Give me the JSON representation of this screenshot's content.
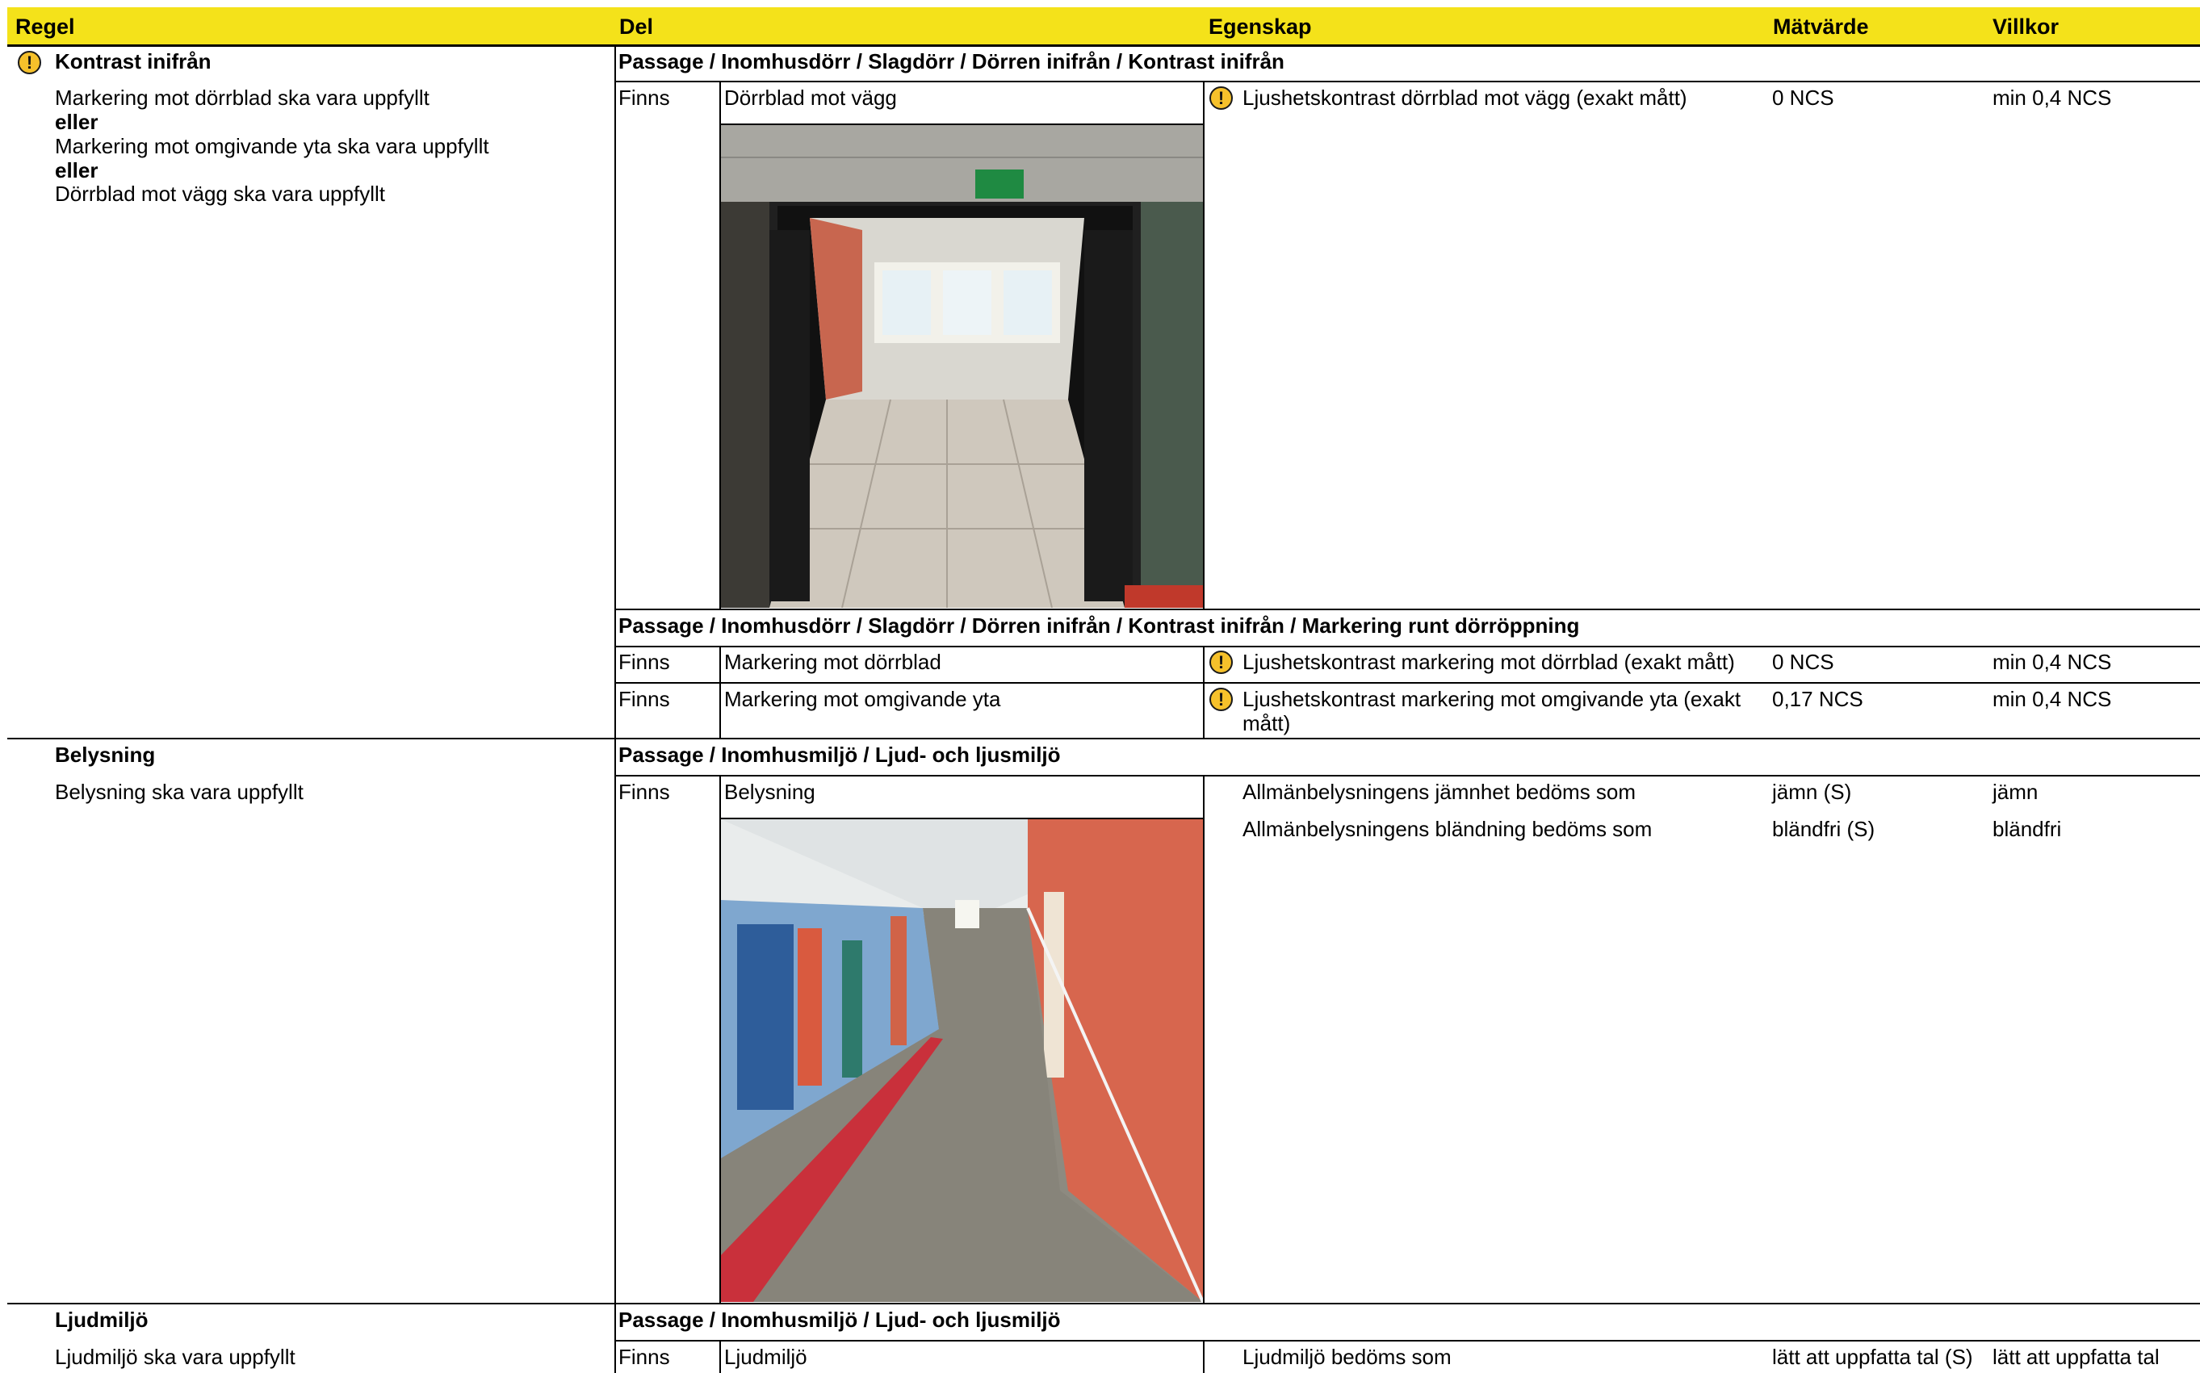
{
  "header": {
    "regel": "Regel",
    "del": "Del",
    "egenskap": "Egenskap",
    "matvarde": "Mätvärde",
    "villkor": "Villkor"
  },
  "colors": {
    "header_bg": "#f4e21a",
    "warning": "#f6c12b"
  },
  "icons": {
    "warning": "warning-icon"
  },
  "sections": [
    {
      "rule_title": "Kontrast inifrån",
      "rule_lines": [
        "Markering mot dörrblad ska vara uppfyllt",
        "eller",
        "Markering mot omgivande yta ska vara uppfyllt",
        "eller",
        "Dörrblad mot vägg ska vara uppfyllt"
      ],
      "groups": [
        {
          "path": "Passage / Inomhusdörr / Slagdörr / Dörren inifrån / Kontrast inifrån",
          "rows": [
            {
              "status": "Finns",
              "part": "Dörrblad mot vägg",
              "property": "Ljushetskontrast dörrblad mot vägg (exakt mått)",
              "value": "0 NCS",
              "condition": "min 0,4 NCS"
            }
          ]
        },
        {
          "path": "Passage / Inomhusdörr / Slagdörr / Dörren inifrån / Kontrast inifrån / Markering runt dörröppning",
          "rows": [
            {
              "status": "Finns",
              "part": "Markering mot dörrblad",
              "property": "Ljushetskontrast markering mot dörrblad (exakt mått)",
              "value": "0 NCS",
              "condition": "min 0,4 NCS"
            },
            {
              "status": "Finns",
              "part": "Markering mot omgivande yta",
              "property": "Ljushetskontrast markering mot omgivande yta (exakt",
              "property_line2": "mått)",
              "value": "0,17 NCS",
              "condition": "min 0,4 NCS"
            }
          ]
        }
      ]
    },
    {
      "rule_title": "Belysning",
      "rule_lines": [
        "Belysning ska vara uppfyllt"
      ],
      "groups": [
        {
          "path": "Passage / Inomhusmiljö / Ljud- och ljusmiljö",
          "rows": [
            {
              "status": "Finns",
              "part": "Belysning",
              "property": "Allmänbelysningens jämnhet bedöms som",
              "value": "jämn (S)",
              "condition": "jämn"
            },
            {
              "property": "Allmänbelysningens bländning bedöms som",
              "value": "bländfri (S)",
              "condition": "bländfri"
            }
          ]
        }
      ]
    },
    {
      "rule_title": "Ljudmiljö",
      "rule_lines": [
        "Ljudmiljö ska vara uppfyllt"
      ],
      "groups": [
        {
          "path": "Passage / Inomhusmiljö / Ljud- och ljusmiljö",
          "rows": [
            {
              "status": "Finns",
              "part": "Ljudmiljö",
              "property": "Ljudmiljö bedöms som",
              "value": "lätt att uppfatta tal (S)",
              "condition": "lätt att uppfatta tal"
            }
          ]
        }
      ]
    }
  ]
}
